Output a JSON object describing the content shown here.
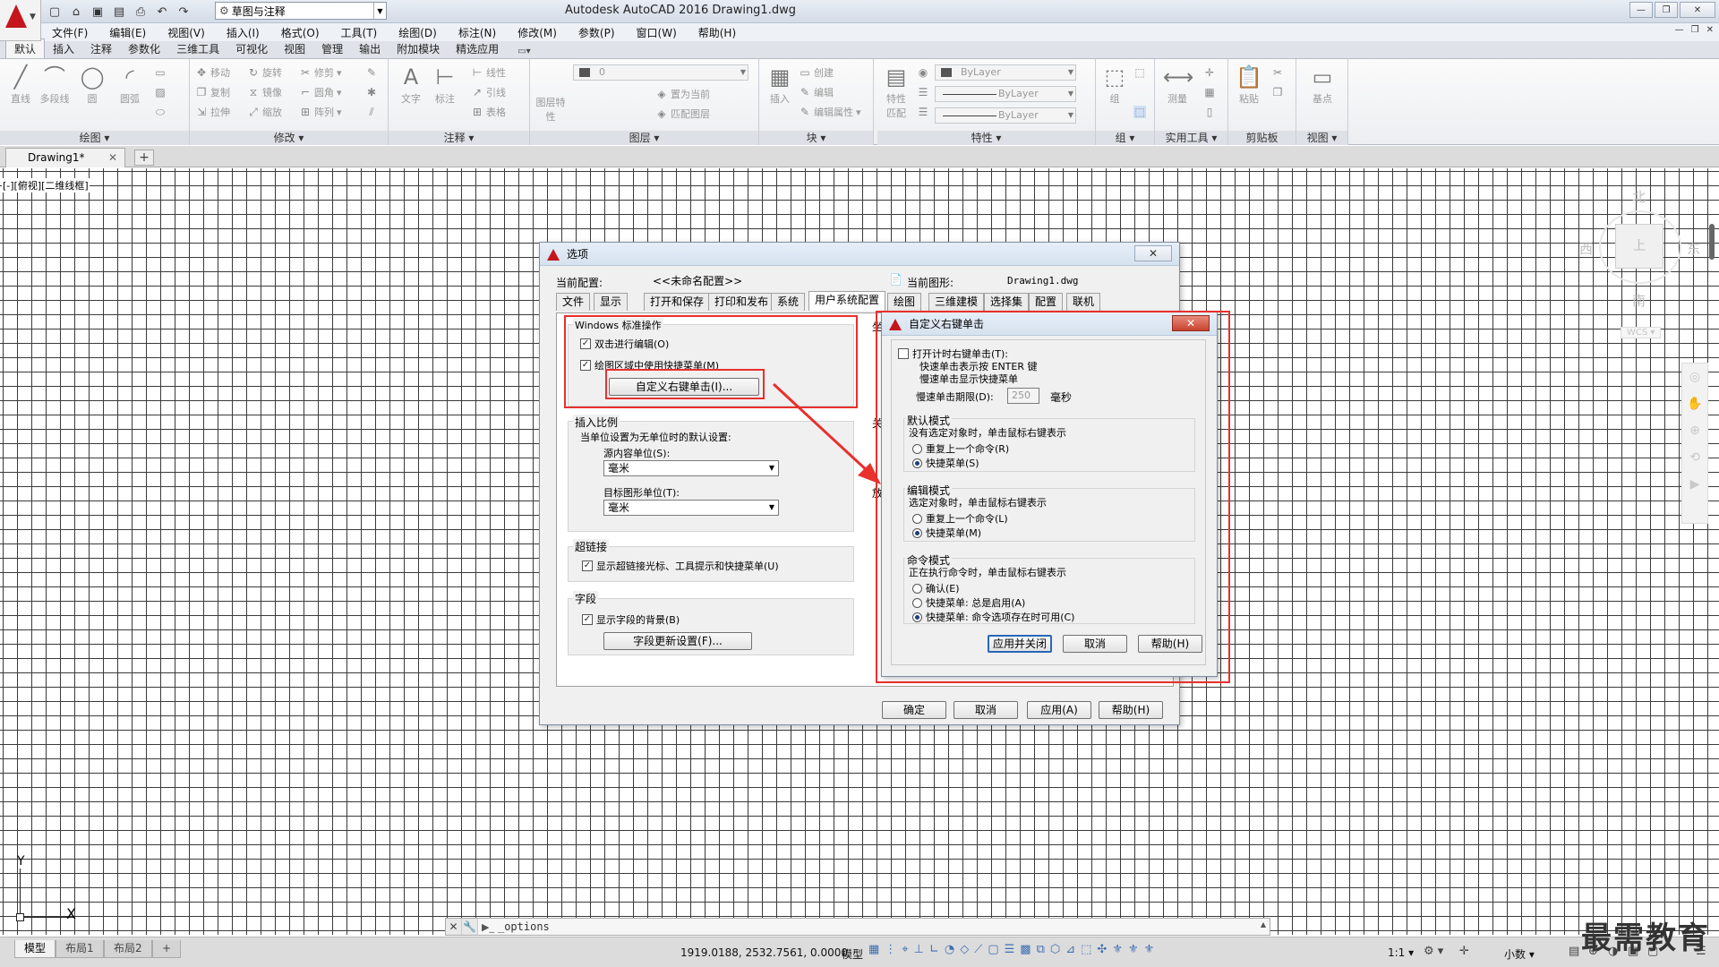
{
  "app": {
    "title": "Autodesk AutoCAD 2016    Drawing1.dwg",
    "workspace": "草图与注释"
  },
  "menu": [
    "文件(F)",
    "编辑(E)",
    "视图(V)",
    "插入(I)",
    "格式(O)",
    "工具(T)",
    "绘图(D)",
    "标注(N)",
    "修改(M)",
    "参数(P)",
    "窗口(W)",
    "帮助(H)"
  ],
  "ribbon_tabs": [
    "默认",
    "插入",
    "注释",
    "参数化",
    "三维工具",
    "可视化",
    "视图",
    "管理",
    "输出",
    "附加模块",
    "精选应用"
  ],
  "ribbon": {
    "draw": {
      "title": "绘图",
      "tools": [
        "直线",
        "多段线",
        "圆",
        "圆弧"
      ]
    },
    "modify": {
      "title": "修改",
      "tools": [
        "移动",
        "旋转",
        "修剪",
        "复制",
        "镜像",
        "圆角",
        "拉伸",
        "缩放",
        "阵列"
      ]
    },
    "annotation": {
      "title": "注释",
      "tools": [
        "文字",
        "标注",
        "线性",
        "引线",
        "表格"
      ]
    },
    "layers": {
      "title": "图层",
      "tools": [
        "图层特性",
        "置为当前",
        "匹配图层"
      ],
      "current_layer": "0"
    },
    "block": {
      "title": "块",
      "tools": [
        "插入",
        "创建",
        "编辑",
        "编辑属性"
      ]
    },
    "properties": {
      "title": "特性",
      "tools": [
        "特性匹配"
      ],
      "color": "ByLayer",
      "linetype": "ByLayer",
      "lineweight": "ByLayer"
    },
    "groups": {
      "title": "组",
      "tools": [
        "组"
      ]
    },
    "utilities": {
      "title": "实用工具",
      "tools": [
        "测量"
      ]
    },
    "clipboard": {
      "title": "剪贴板",
      "tools": [
        "粘贴"
      ]
    },
    "view": {
      "title": "视图",
      "tools": [
        "基点"
      ]
    }
  },
  "doc_tab": {
    "name": "Drawing1*"
  },
  "viewport_label": "[-][俯视][二维线框]",
  "viewcube": {
    "north": "北",
    "south": "南",
    "east": "东",
    "west": "西",
    "top": "上",
    "wcs": "WCS"
  },
  "ucs": {
    "x": "X",
    "y": "Y"
  },
  "command_line": {
    "value": "_options"
  },
  "layout_tabs": [
    "模型",
    "布局1",
    "布局2"
  ],
  "status": {
    "coords": "1919.0188, 2532.7561, 0.0000",
    "model": "模型",
    "scale": "1:1",
    "units": "小数"
  },
  "watermark": "最需教育",
  "options_dialog": {
    "title": "选项",
    "profile_label": "当前配置:",
    "profile_value": "<<未命名配置>>",
    "drawing_label": "当前图形:",
    "drawing_value": "Drawing1.dwg",
    "tabs": [
      "文件",
      "显示",
      "打开和保存",
      "打印和发布",
      "系统",
      "用户系统配置",
      "绘图",
      "三维建模",
      "选择集",
      "配置",
      "联机"
    ],
    "active_tab": "用户系统配置",
    "windows_group": {
      "title": "Windows 标准操作",
      "dblclick_edit": "双击进行编辑(O)",
      "shortcut_menu": "绘图区域中使用快捷菜单(M)",
      "custom_right_click_button": "自定义右键单击(I)..."
    },
    "insert_scale": {
      "title": "插入比例",
      "desc": "当单位设置为无单位时的默认设置:",
      "source_label": "源内容单位(S):",
      "source_value": "毫米",
      "target_label": "目标图形单位(T):",
      "target_value": "毫米"
    },
    "hyperlink": {
      "title": "超链接",
      "option": "显示超链接光标、工具提示和快捷菜单(U)"
    },
    "fields": {
      "title": "字段",
      "option": "显示字段的背景(B)",
      "button": "字段更新设置(F)..."
    },
    "right_partial": {
      "a": "坐",
      "b": "关",
      "c": "放"
    },
    "buttons": {
      "ok": "确定",
      "cancel": "取消",
      "apply": "应用(A)",
      "help": "帮助(H)"
    }
  },
  "right_click_dialog": {
    "title": "自定义右键单击",
    "timed_option": "打开计时右键单击(T):",
    "fast_click": "快速单击表示按 ENTER 键",
    "slow_click": "慢速单击显示快捷菜单",
    "duration_label": "慢速单击期限(D):",
    "duration_value": "250",
    "duration_unit": "毫秒",
    "default_mode": {
      "title": "默认模式",
      "desc": "没有选定对象时，单击鼠标右键表示",
      "opt1": "重复上一个命令(R)",
      "opt2": "快捷菜单(S)"
    },
    "edit_mode": {
      "title": "编辑模式",
      "desc": "选定对象时，单击鼠标右键表示",
      "opt1": "重复上一个命令(L)",
      "opt2": "快捷菜单(M)"
    },
    "command_mode": {
      "title": "命令模式",
      "desc": "正在执行命令时，单击鼠标右键表示",
      "opt1": "确认(E)",
      "opt2": "快捷菜单: 总是启用(A)",
      "opt3": "快捷菜单: 命令选项存在时可用(C)"
    },
    "buttons": {
      "apply_close": "应用并关闭",
      "cancel": "取消",
      "help": "帮助(H)"
    }
  },
  "colors": {
    "accent": "#c4161c",
    "highlight": "#e8302d"
  }
}
